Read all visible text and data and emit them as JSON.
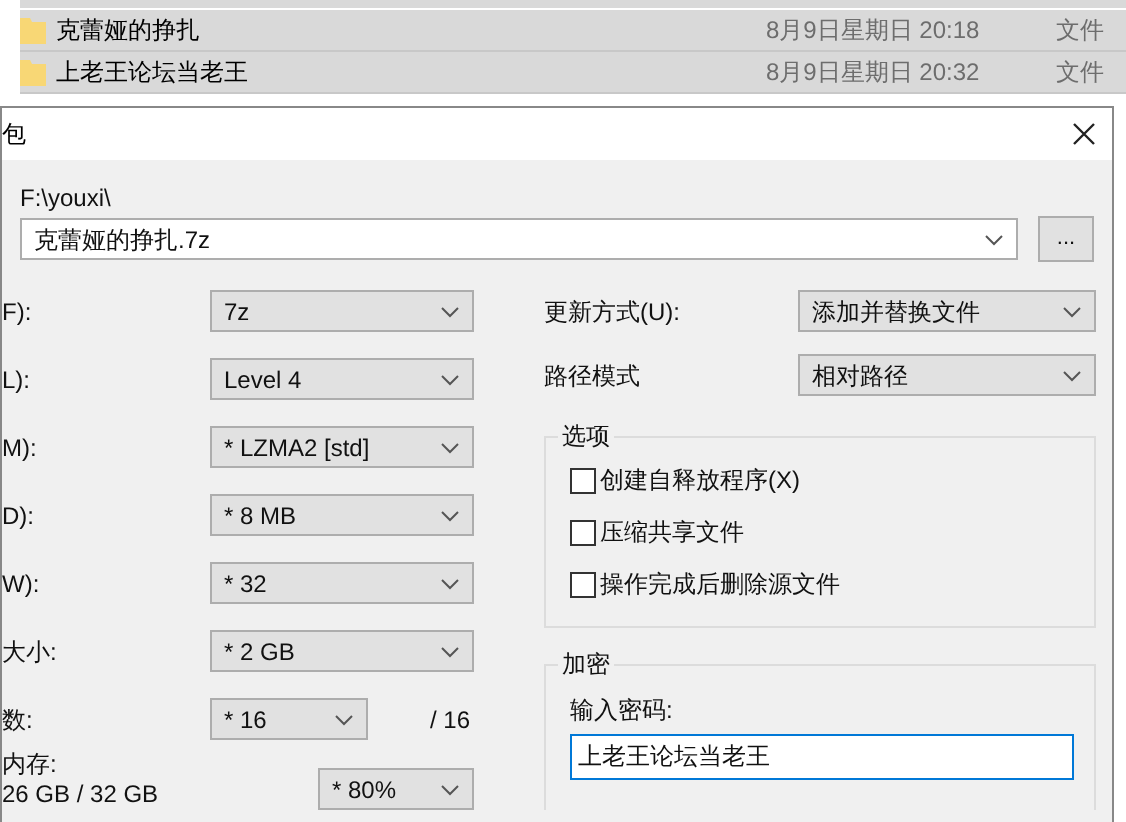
{
  "file_list": {
    "rows": [
      {
        "name": "克蕾娅的挣扎",
        "modified": "8月9日星期日 20:18",
        "type": "文件"
      },
      {
        "name": "上老王论坛当老王",
        "modified": "8月9日星期日 20:32",
        "type": "文件"
      }
    ]
  },
  "dialog": {
    "title": "包",
    "path_label": "F:\\youxi\\",
    "archive_name": "克蕾娅的挣扎.7z",
    "browse_button": "...",
    "left_fields": [
      {
        "kind": "combo",
        "label": "F):",
        "value": "7z"
      },
      {
        "kind": "combo",
        "label": "L):",
        "value": "Level 4"
      },
      {
        "kind": "combo",
        "label": "M):",
        "value": "* LZMA2 [std]"
      },
      {
        "kind": "combo",
        "label": "D):",
        "value": "* 8 MB"
      },
      {
        "kind": "combo",
        "label": "W):",
        "value": "* 32"
      },
      {
        "kind": "combo",
        "label": "大小:",
        "value": "* 2 GB"
      },
      {
        "kind": "threads",
        "label": "数:",
        "value": "* 16",
        "suffix": "/ 16"
      }
    ],
    "memory": {
      "label": "内存:",
      "usage": "26 GB / 32 GB",
      "value": "* 80%"
    },
    "update_mode": {
      "label": "更新方式(U):",
      "value": "添加并替换文件"
    },
    "path_mode": {
      "label": "路径模式",
      "value": "相对路径"
    },
    "options": {
      "title": "选项",
      "checkboxes": [
        {
          "label": "创建自释放程序(X)",
          "checked": false
        },
        {
          "label": "压缩共享文件",
          "checked": false
        },
        {
          "label": "操作完成后删除源文件",
          "checked": false
        }
      ]
    },
    "encryption": {
      "title": "加密",
      "password_label": "输入密码:",
      "password": "上老王论坛当老王"
    }
  }
}
